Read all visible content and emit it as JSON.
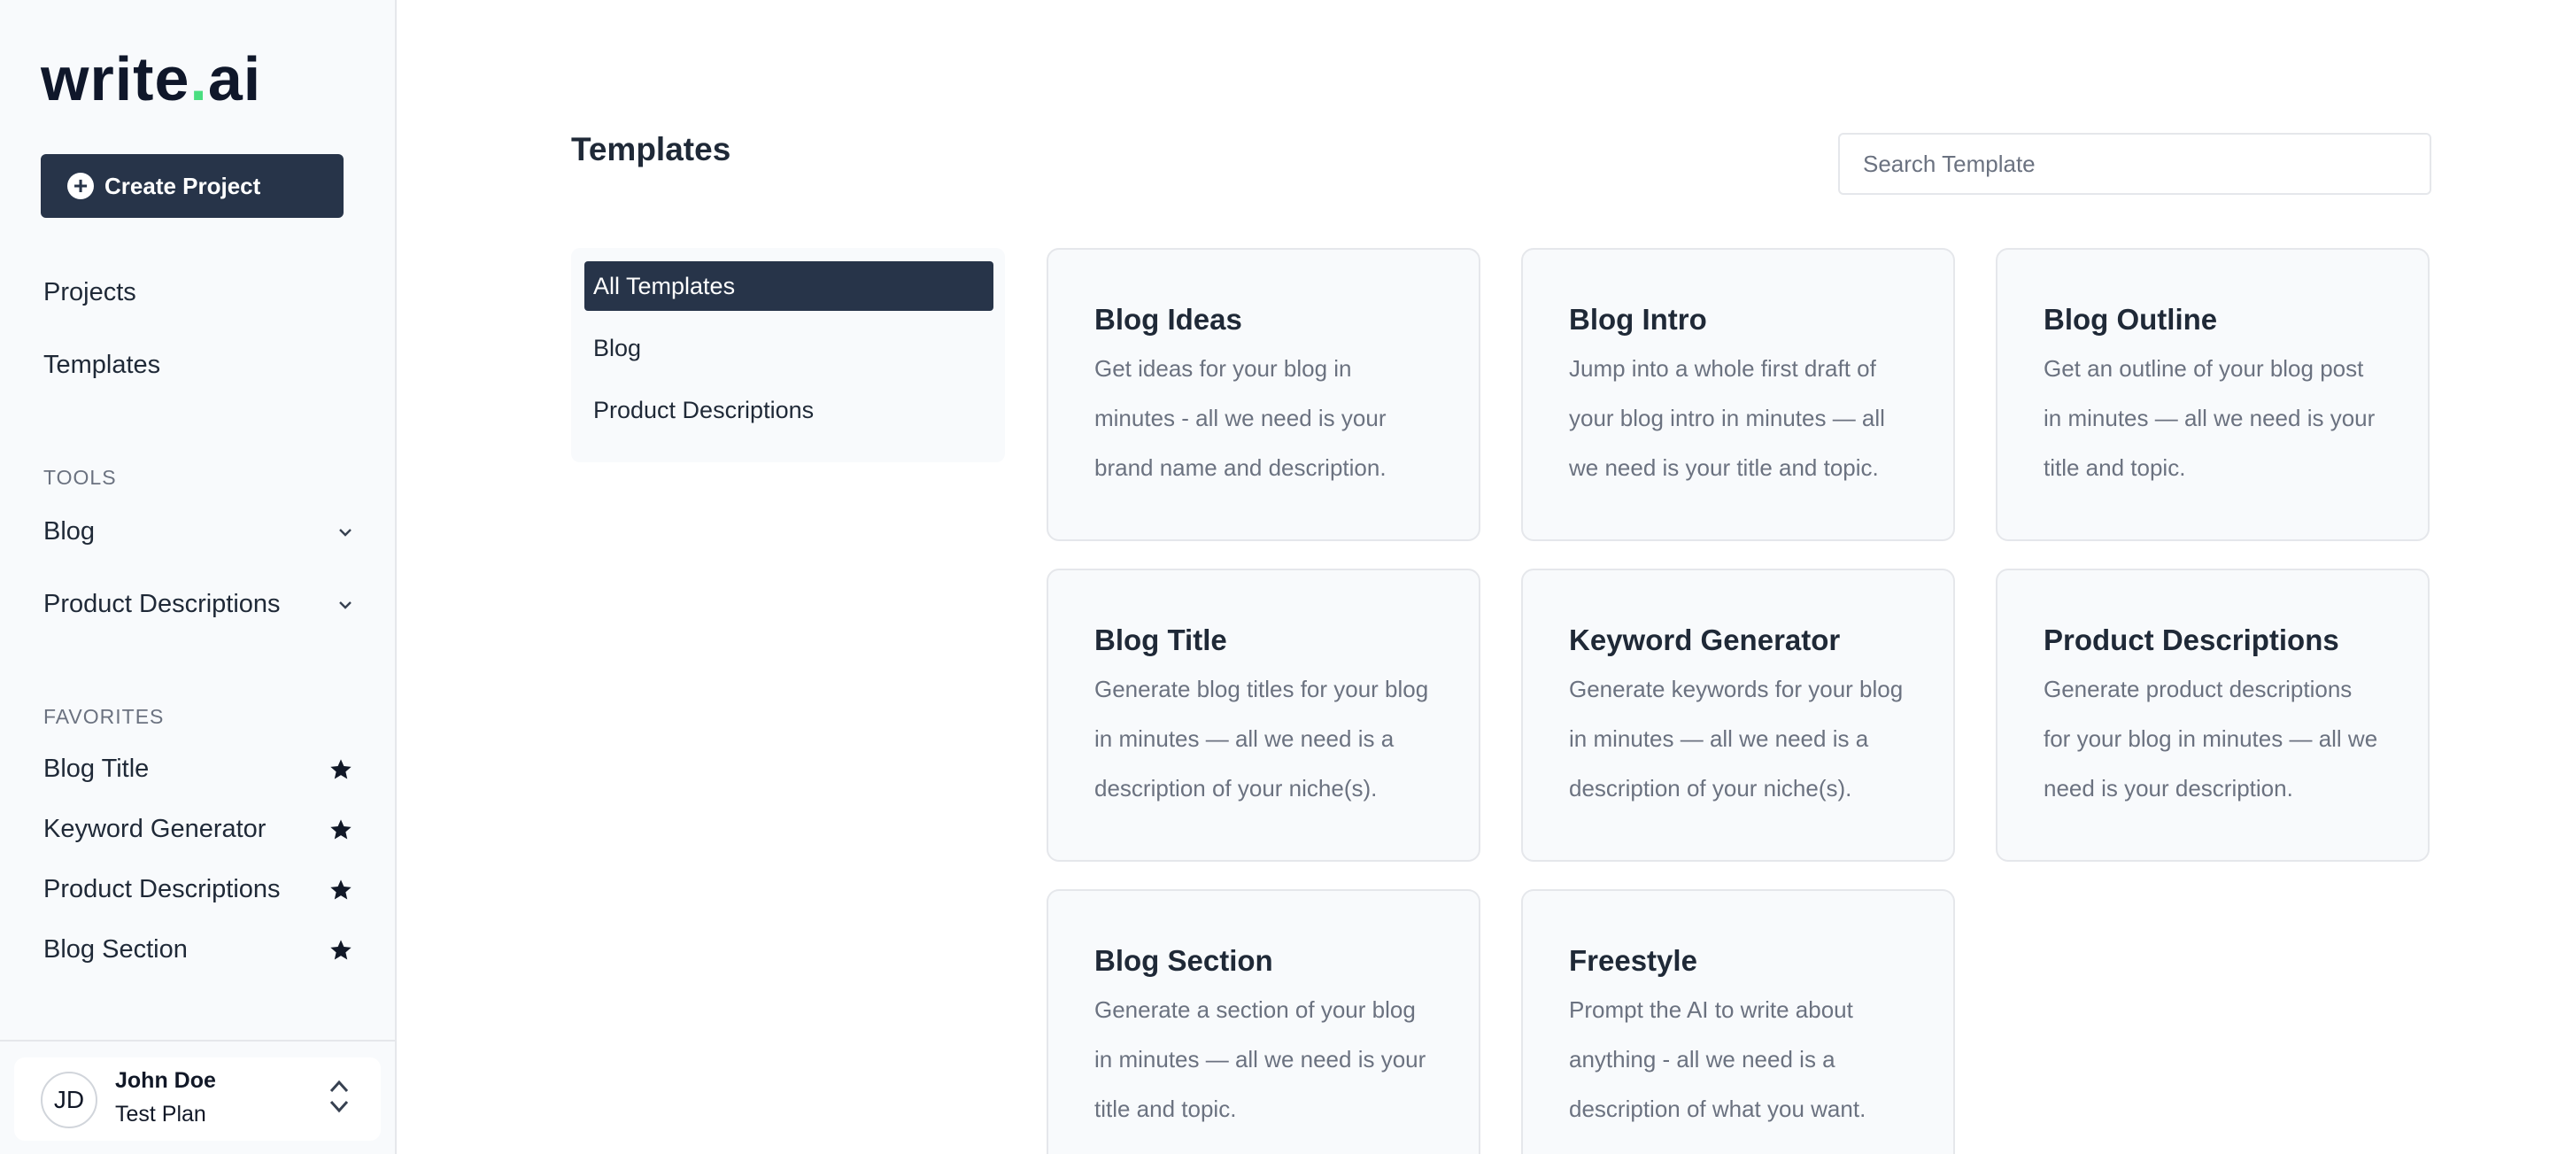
{
  "sidebar": {
    "logo": {
      "prefix": "write",
      "dot": ".",
      "suffix": "ai"
    },
    "create_label": "Create Project",
    "nav": [
      "Projects",
      "Templates"
    ],
    "tools_label": "TOOLS",
    "tools": [
      "Blog",
      "Product Descriptions"
    ],
    "favorites_label": "FAVORITES",
    "favorites": [
      "Blog Title",
      "Keyword Generator",
      "Product Descriptions",
      "Blog Section"
    ],
    "user": {
      "initials": "JD",
      "name": "John Doe",
      "plan": "Test Plan"
    }
  },
  "main": {
    "title": "Templates",
    "search_placeholder": "Search Template",
    "filters": [
      "All Templates",
      "Blog",
      "Product Descriptions"
    ],
    "active_filter": "All Templates",
    "cards": [
      {
        "title": "Blog Ideas",
        "desc": "Get ideas for your blog in minutes - all we need is your brand name and description."
      },
      {
        "title": "Blog Intro",
        "desc": "Jump into a whole first draft of your blog intro in minutes — all we need is your title and topic."
      },
      {
        "title": "Blog Outline",
        "desc": "Get an outline of your blog post in minutes — all we need is your title and topic."
      },
      {
        "title": "Blog Title",
        "desc": "Generate blog titles for your blog in minutes — all we need is a description of your niche(s)."
      },
      {
        "title": "Keyword Generator",
        "desc": "Generate keywords for your blog in minutes — all we need is a description of your niche(s)."
      },
      {
        "title": "Product Descriptions",
        "desc": "Generate product descriptions for your blog in minutes — all we need is your description."
      },
      {
        "title": "Blog Section",
        "desc": "Generate a section of your blog in minutes — all we need is your title and topic."
      },
      {
        "title": "Freestyle",
        "desc": "Prompt the AI to write about anything - all we need is a description of what you want."
      }
    ]
  },
  "colors": {
    "accent": "#273449",
    "logo_dot": "#4ade80",
    "card_bg": "#f8fafc"
  },
  "icons": {
    "create": "plus-circle-icon",
    "chevron": "chevron-down-icon",
    "favorite": "star-icon",
    "user_menu": "chevron-up-down-icon"
  }
}
